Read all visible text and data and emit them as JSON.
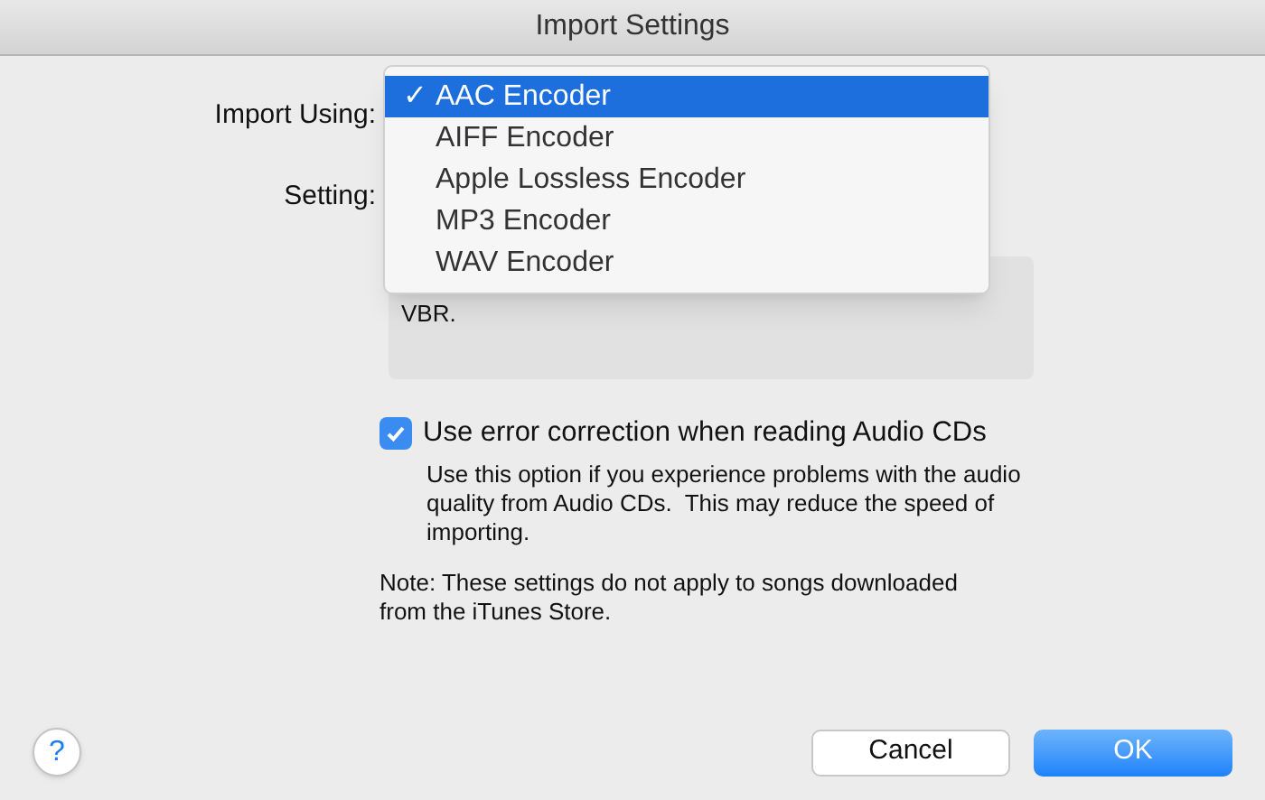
{
  "window": {
    "title": "Import Settings"
  },
  "import_using": {
    "label": "Import Using:"
  },
  "setting": {
    "label": "Setting:"
  },
  "menu": {
    "check_mark": "✓",
    "items": [
      {
        "label": "AAC Encoder",
        "selected": true
      },
      {
        "label": "AIFF Encoder",
        "selected": false
      },
      {
        "label": "Apple Lossless Encoder",
        "selected": false
      },
      {
        "label": "MP3 Encoder",
        "selected": false
      },
      {
        "label": "WAV Encoder",
        "selected": false
      }
    ]
  },
  "details": {
    "text": "VBR."
  },
  "error_correction": {
    "label": "Use error correction when reading Audio CDs",
    "checked": true,
    "description": "Use this option if you experience problems with the audio quality from Audio CDs.  This may reduce the speed of importing."
  },
  "note": "Note: These settings do not apply to songs downloaded from the iTunes Store.",
  "help": "?",
  "buttons": [
    {
      "label": "Cancel",
      "kind": "secondary"
    },
    {
      "label": "OK",
      "kind": "primary"
    }
  ]
}
